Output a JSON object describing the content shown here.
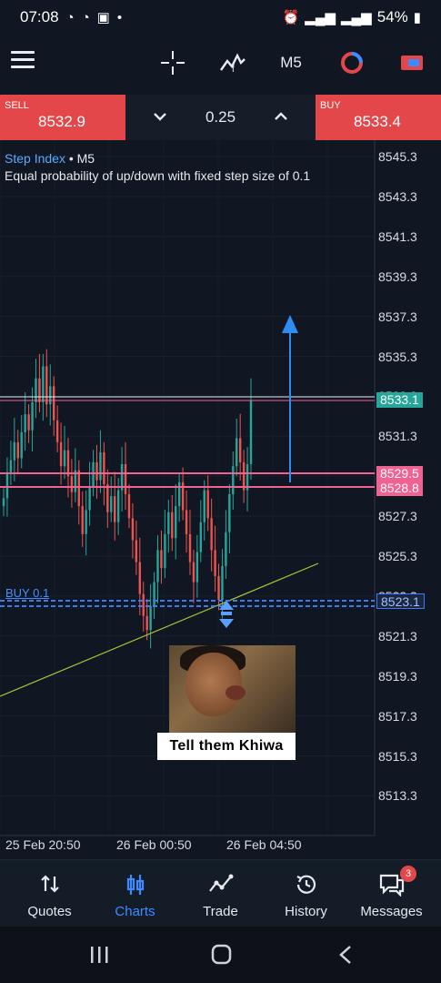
{
  "status": {
    "time": "07:08",
    "battery": "54%"
  },
  "toolbar": {
    "timeframe": "M5"
  },
  "trade": {
    "sell_label": "SELL",
    "sell_price": "8532.9",
    "lot": "0.25",
    "buy_label": "BUY",
    "buy_price": "8533.4"
  },
  "chart": {
    "symbol": "Step Index",
    "symbol_tf": " • M5",
    "description": "Equal probability of up/down with fixed step size of 0.1",
    "buy_line_label": "BUY 0.1",
    "tags": {
      "current": "8533.1",
      "upper": "8529.5",
      "lower": "8528.8",
      "entry": "8523.1"
    },
    "meme_caption": "Tell them Khiwa"
  },
  "chart_data": {
    "type": "candlestick",
    "y_ticks": [
      "8545.3",
      "8543.3",
      "8541.3",
      "8539.3",
      "8537.3",
      "8535.3",
      "8533.3",
      "8531.3",
      "8529.3",
      "8527.3",
      "8525.3",
      "8523.3",
      "8521.3",
      "8519.3",
      "8517.3",
      "8515.3",
      "8513.3"
    ],
    "x_ticks": [
      "25 Feb 20:50",
      "26 Feb 00:50",
      "26 Feb 04:50"
    ],
    "ylim": [
      8512.3,
      8546.3
    ],
    "horizontal_levels": [
      8533.1,
      8529.5,
      8528.8,
      8523.1
    ],
    "closes": [
      8528.2,
      8529.5,
      8530.1,
      8531.0,
      8530.2,
      8531.5,
      8532.4,
      8531.6,
      8533.0,
      8534.2,
      8533.0,
      8534.8,
      8532.9,
      8533.8,
      8532.1,
      8531.0,
      8529.8,
      8530.6,
      8529.3,
      8528.5,
      8529.6,
      8527.8,
      8526.4,
      8527.6,
      8528.8,
      8530.0,
      8529.1,
      8530.5,
      8528.9,
      8527.5,
      8528.3,
      8527.0,
      8528.6,
      8529.9,
      8528.4,
      8527.2,
      8526.1,
      8525.0,
      8523.4,
      8522.3,
      8521.6,
      8522.8,
      8524.0,
      8525.6,
      8524.7,
      8526.4,
      8527.5,
      8526.2,
      8527.8,
      8529.0,
      8527.6,
      8526.4,
      8525.0,
      8524.0,
      8525.5,
      8527.0,
      8528.6,
      8527.2,
      8525.6,
      8524.3,
      8523.1,
      8524.8,
      8526.5,
      8528.4,
      8529.8,
      8531.2,
      8530.0,
      8528.6,
      8529.9,
      8533.1
    ]
  },
  "nav": [
    {
      "label": "Quotes"
    },
    {
      "label": "Charts"
    },
    {
      "label": "Trade"
    },
    {
      "label": "History"
    },
    {
      "label": "Messages",
      "badge": "3"
    }
  ],
  "colors": {
    "sell": "#e4474a",
    "buy": "#e4474a",
    "bull": "#26a69a",
    "bear": "#ef5350",
    "active": "#3d8bff"
  }
}
